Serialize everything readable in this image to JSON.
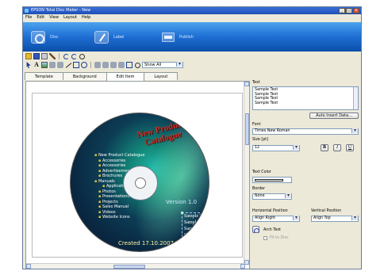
{
  "window": {
    "title": "EPSON Total Disc Maker - New"
  },
  "window_buttons": {
    "minimize": "_",
    "maximize": "□",
    "close": "x"
  },
  "menu": [
    "File",
    "Edit",
    "View",
    "Layout",
    "Help"
  ],
  "steps": {
    "disc": "Disc",
    "label": "Label",
    "publish": "Publish"
  },
  "toolbar": {
    "show_all": "Show All",
    "text_tool": "A"
  },
  "tabs": [
    "Template",
    "Background",
    "Edit Item",
    "Layout"
  ],
  "disc": {
    "title_line1": "New Product",
    "title_line2": "Catalogue",
    "tree": [
      {
        "label": "New Product Catalogue",
        "level": 0
      },
      {
        "label": "Accessories",
        "level": 1
      },
      {
        "label": "Accessories",
        "level": 1
      },
      {
        "label": "Advertisements",
        "level": 1
      },
      {
        "label": "Brochures",
        "level": 1
      },
      {
        "label": "Manuals",
        "level": 0
      },
      {
        "label": "Application",
        "level": 2
      },
      {
        "label": "Photos",
        "level": 1
      },
      {
        "label": "Presentations",
        "level": 1
      },
      {
        "label": "Projects",
        "level": 1
      },
      {
        "label": "Sales Manual",
        "level": 1
      },
      {
        "label": "Videos",
        "level": 1
      },
      {
        "label": "Website Icons",
        "level": 1
      }
    ],
    "version": "Version 1.0",
    "created": "Created 17.10.2007",
    "sample_texts": [
      "Sample Text",
      "Sample Text",
      "Sample Text",
      "Sample Text"
    ]
  },
  "panel": {
    "text_label": "Text",
    "text_lines": [
      "Sample Text",
      "Sample Text",
      "Sample Text",
      "Sample Text"
    ],
    "auto_insert": "Auto Insert Data...",
    "font_label": "Font",
    "font_value": "Times New Roman",
    "size_label": "Size [pt]",
    "size_value": "12",
    "bold": "B",
    "italic": "I",
    "underline": "U",
    "text_color_label": "Text Color",
    "border_label": "Border",
    "border_value": "None",
    "hpos_label": "Horizontal Position",
    "hpos_value": "Align Right",
    "vpos_label": "Vertical Position",
    "vpos_value": "Align Top",
    "arch_text": "Arch Text",
    "fit_to_disc": "Fit to Disc"
  }
}
